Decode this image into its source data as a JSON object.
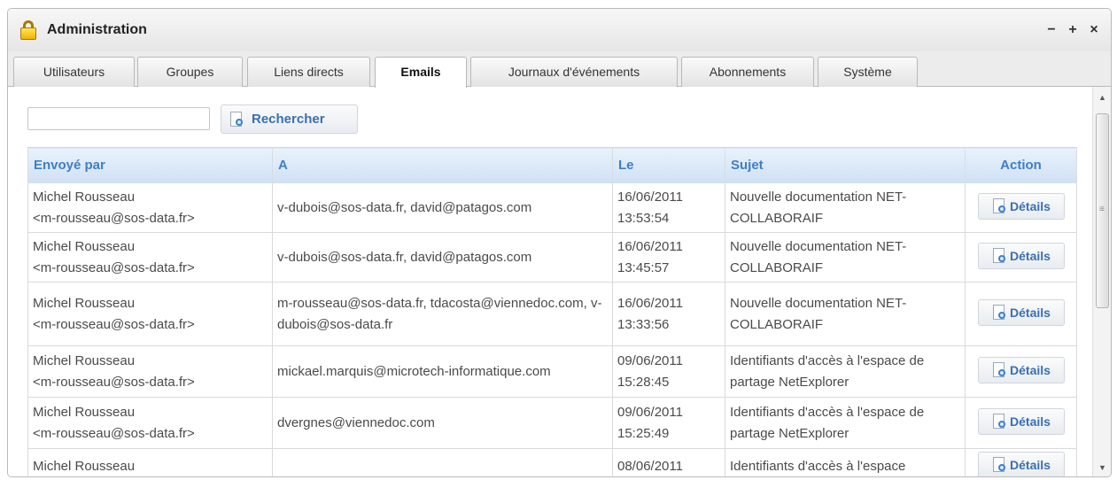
{
  "window": {
    "title": "Administration",
    "controls": {
      "minimize": "−",
      "maximize": "+",
      "close": "×"
    }
  },
  "tabs": [
    {
      "label": "Utilisateurs",
      "active": false
    },
    {
      "label": "Groupes",
      "active": false
    },
    {
      "label": "Liens directs",
      "active": false
    },
    {
      "label": "Emails",
      "active": true
    },
    {
      "label": "Journaux d'événements",
      "active": false
    },
    {
      "label": "Abonnements",
      "active": false
    },
    {
      "label": "Système",
      "active": false
    }
  ],
  "search": {
    "value": "",
    "placeholder": "",
    "button_label": "Rechercher"
  },
  "table": {
    "headers": {
      "sender": "Envoyé par",
      "to": "A",
      "date": "Le",
      "subject": "Sujet",
      "action": "Action"
    },
    "rows": [
      {
        "sender_name": "Michel Rousseau",
        "sender_email": "<m-rousseau@sos-data.fr>",
        "to": "v-dubois@sos-data.fr, david@patagos.com",
        "date": "16/06/2011",
        "time": "13:53:54",
        "subject": "Nouvelle documentation NET-COLLABORAIF",
        "action": "Détails"
      },
      {
        "sender_name": "Michel Rousseau",
        "sender_email": "<m-rousseau@sos-data.fr>",
        "to": "v-dubois@sos-data.fr, david@patagos.com",
        "date": "16/06/2011",
        "time": "13:45:57",
        "subject": "Nouvelle documentation NET-COLLABORAIF",
        "action": "Détails"
      },
      {
        "sender_name": "Michel Rousseau",
        "sender_email": "<m-rousseau@sos-data.fr>",
        "to": "m-rousseau@sos-data.fr, tdacosta@viennedoc.com, v-dubois@sos-data.fr",
        "date": "16/06/2011",
        "time": "13:33:56",
        "subject": "Nouvelle documentation NET-COLLABORAIF",
        "action": "Détails"
      },
      {
        "sender_name": "Michel Rousseau",
        "sender_email": "<m-rousseau@sos-data.fr>",
        "to": "mickael.marquis@microtech-informatique.com",
        "date": "09/06/2011",
        "time": "15:28:45",
        "subject": "Identifiants d'accès à l'espace de partage NetExplorer",
        "action": "Détails"
      },
      {
        "sender_name": "Michel Rousseau",
        "sender_email": "<m-rousseau@sos-data.fr>",
        "to": "dvergnes@viennedoc.com",
        "date": "09/06/2011",
        "time": "15:25:49",
        "subject": "Identifiants d'accès à l'espace de partage NetExplorer",
        "action": "Détails"
      },
      {
        "sender_name": "Michel Rousseau",
        "sender_email": "",
        "to": "",
        "date": "08/06/2011",
        "time": "",
        "subject": "Identifiants d'accès à l'espace",
        "action": "Détails"
      }
    ]
  }
}
